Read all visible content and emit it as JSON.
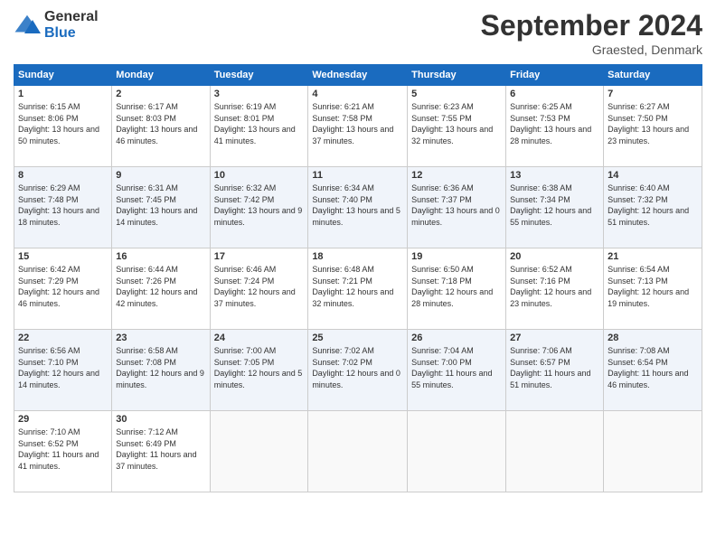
{
  "logo": {
    "general": "General",
    "blue": "Blue"
  },
  "header": {
    "title": "September 2024",
    "location": "Graested, Denmark"
  },
  "days_of_week": [
    "Sunday",
    "Monday",
    "Tuesday",
    "Wednesday",
    "Thursday",
    "Friday",
    "Saturday"
  ],
  "weeks": [
    [
      {
        "day": 1,
        "sunrise": "6:15 AM",
        "sunset": "8:06 PM",
        "daylight": "13 hours and 50 minutes."
      },
      {
        "day": 2,
        "sunrise": "6:17 AM",
        "sunset": "8:03 PM",
        "daylight": "13 hours and 46 minutes."
      },
      {
        "day": 3,
        "sunrise": "6:19 AM",
        "sunset": "8:01 PM",
        "daylight": "13 hours and 41 minutes."
      },
      {
        "day": 4,
        "sunrise": "6:21 AM",
        "sunset": "7:58 PM",
        "daylight": "13 hours and 37 minutes."
      },
      {
        "day": 5,
        "sunrise": "6:23 AM",
        "sunset": "7:55 PM",
        "daylight": "13 hours and 32 minutes."
      },
      {
        "day": 6,
        "sunrise": "6:25 AM",
        "sunset": "7:53 PM",
        "daylight": "13 hours and 28 minutes."
      },
      {
        "day": 7,
        "sunrise": "6:27 AM",
        "sunset": "7:50 PM",
        "daylight": "13 hours and 23 minutes."
      }
    ],
    [
      {
        "day": 8,
        "sunrise": "6:29 AM",
        "sunset": "7:48 PM",
        "daylight": "13 hours and 18 minutes."
      },
      {
        "day": 9,
        "sunrise": "6:31 AM",
        "sunset": "7:45 PM",
        "daylight": "13 hours and 14 minutes."
      },
      {
        "day": 10,
        "sunrise": "6:32 AM",
        "sunset": "7:42 PM",
        "daylight": "13 hours and 9 minutes."
      },
      {
        "day": 11,
        "sunrise": "6:34 AM",
        "sunset": "7:40 PM",
        "daylight": "13 hours and 5 minutes."
      },
      {
        "day": 12,
        "sunrise": "6:36 AM",
        "sunset": "7:37 PM",
        "daylight": "13 hours and 0 minutes."
      },
      {
        "day": 13,
        "sunrise": "6:38 AM",
        "sunset": "7:34 PM",
        "daylight": "12 hours and 55 minutes."
      },
      {
        "day": 14,
        "sunrise": "6:40 AM",
        "sunset": "7:32 PM",
        "daylight": "12 hours and 51 minutes."
      }
    ],
    [
      {
        "day": 15,
        "sunrise": "6:42 AM",
        "sunset": "7:29 PM",
        "daylight": "12 hours and 46 minutes."
      },
      {
        "day": 16,
        "sunrise": "6:44 AM",
        "sunset": "7:26 PM",
        "daylight": "12 hours and 42 minutes."
      },
      {
        "day": 17,
        "sunrise": "6:46 AM",
        "sunset": "7:24 PM",
        "daylight": "12 hours and 37 minutes."
      },
      {
        "day": 18,
        "sunrise": "6:48 AM",
        "sunset": "7:21 PM",
        "daylight": "12 hours and 32 minutes."
      },
      {
        "day": 19,
        "sunrise": "6:50 AM",
        "sunset": "7:18 PM",
        "daylight": "12 hours and 28 minutes."
      },
      {
        "day": 20,
        "sunrise": "6:52 AM",
        "sunset": "7:16 PM",
        "daylight": "12 hours and 23 minutes."
      },
      {
        "day": 21,
        "sunrise": "6:54 AM",
        "sunset": "7:13 PM",
        "daylight": "12 hours and 19 minutes."
      }
    ],
    [
      {
        "day": 22,
        "sunrise": "6:56 AM",
        "sunset": "7:10 PM",
        "daylight": "12 hours and 14 minutes."
      },
      {
        "day": 23,
        "sunrise": "6:58 AM",
        "sunset": "7:08 PM",
        "daylight": "12 hours and 9 minutes."
      },
      {
        "day": 24,
        "sunrise": "7:00 AM",
        "sunset": "7:05 PM",
        "daylight": "12 hours and 5 minutes."
      },
      {
        "day": 25,
        "sunrise": "7:02 AM",
        "sunset": "7:02 PM",
        "daylight": "12 hours and 0 minutes."
      },
      {
        "day": 26,
        "sunrise": "7:04 AM",
        "sunset": "7:00 PM",
        "daylight": "11 hours and 55 minutes."
      },
      {
        "day": 27,
        "sunrise": "7:06 AM",
        "sunset": "6:57 PM",
        "daylight": "11 hours and 51 minutes."
      },
      {
        "day": 28,
        "sunrise": "7:08 AM",
        "sunset": "6:54 PM",
        "daylight": "11 hours and 46 minutes."
      }
    ],
    [
      {
        "day": 29,
        "sunrise": "7:10 AM",
        "sunset": "6:52 PM",
        "daylight": "11 hours and 41 minutes."
      },
      {
        "day": 30,
        "sunrise": "7:12 AM",
        "sunset": "6:49 PM",
        "daylight": "11 hours and 37 minutes."
      },
      null,
      null,
      null,
      null,
      null
    ]
  ]
}
